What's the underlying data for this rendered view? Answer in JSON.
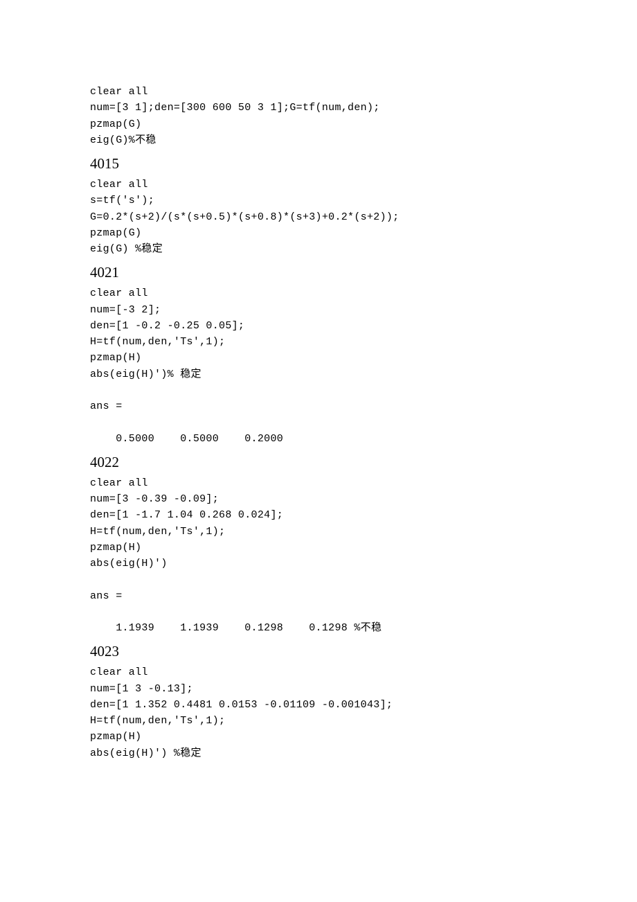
{
  "blocks": {
    "top": "clear all\nnum=[3 1];den=[300 600 50 3 1];G=tf(num,den);\npzmap(G)\neig(G)%不稳",
    "h4015": "4015",
    "b4015": "clear all\ns=tf('s');\nG=0.2*(s+2)/(s*(s+0.5)*(s+0.8)*(s+3)+0.2*(s+2));\npzmap(G)\neig(G) %稳定",
    "h4021": "4021",
    "b4021": "clear all\nnum=[-3 2];\nden=[1 -0.2 -0.25 0.05];\nH=tf(num,den,'Ts',1);\npzmap(H)\nabs(eig(H)')% 稳定\n\nans =\n\n    0.5000    0.5000    0.2000",
    "h4022": "4022",
    "b4022": "clear all\nnum=[3 -0.39 -0.09];\nden=[1 -1.7 1.04 0.268 0.024];\nH=tf(num,den,'Ts',1);\npzmap(H)\nabs(eig(H)')\n\nans =\n\n    1.1939    1.1939    0.1298    0.1298 %不稳",
    "h4023": "4023",
    "b4023": "clear all\nnum=[1 3 -0.13];\nden=[1 1.352 0.4481 0.0153 -0.01109 -0.001043];\nH=tf(num,den,'Ts',1);\npzmap(H)\nabs(eig(H)') %稳定"
  }
}
